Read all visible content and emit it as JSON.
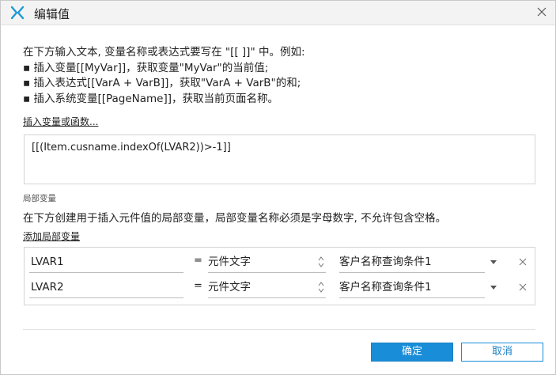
{
  "window": {
    "title": "编辑值",
    "logo_icon": "axure-x-logo-icon",
    "close_icon": "close-icon"
  },
  "intro": {
    "line1": "在下方输入文本, 变量名称或表达式要写在 \"[[ ]]\" 中。例如:",
    "line2": "▪ 插入变量[[MyVar]]，获取变量\"MyVar\"的当前值;",
    "line3": "▪ 插入表达式[[VarA + VarB]]，获取\"VarA + VarB\"的和;",
    "line4": "▪ 插入系统变量[[PageName]]，获取当前页面名称。"
  },
  "insert_link": "插入变量或函数...",
  "expression": "[[(Item.cusname.indexOf(LVAR2))>-1]]",
  "local_vars": {
    "section_label": "局部变量",
    "description": "在下方创建用于插入元件值的局部变量，局部变量名称必须是字母数字, 不允许包含空格。",
    "add_link": "添加局部变量",
    "rows": [
      {
        "name": "LVAR1",
        "eq": "=",
        "type": "元件文字",
        "target": "客户名称查询条件1"
      },
      {
        "name": "LVAR2",
        "eq": "=",
        "type": "元件文字",
        "target": "客户名称查询条件1"
      }
    ]
  },
  "buttons": {
    "ok": "确定",
    "cancel": "取消"
  },
  "colors": {
    "accent": "#1a8dd8",
    "logo": "#1d9ad6",
    "titlebar_bg": "#f3f3f3"
  }
}
